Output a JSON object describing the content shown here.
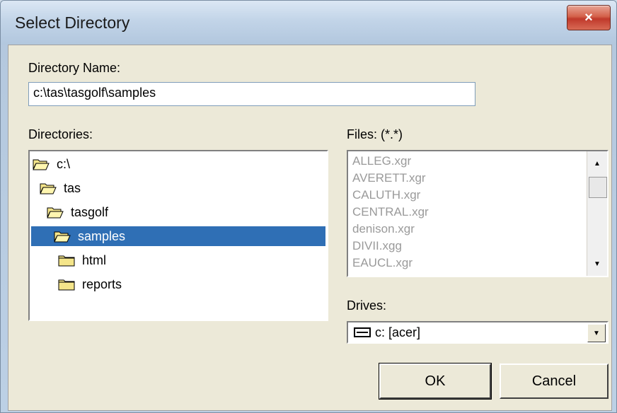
{
  "window": {
    "title": "Select Directory",
    "close_glyph": "×"
  },
  "directory_name": {
    "label": "Directory Name:",
    "value": "c:\\tas\\tasgolf\\samples"
  },
  "directories": {
    "label": "Directories:",
    "items": [
      {
        "label": "c:\\",
        "icon": "open-folder-icon",
        "selected": false
      },
      {
        "label": "tas",
        "icon": "open-folder-icon",
        "selected": false
      },
      {
        "label": "tasgolf",
        "icon": "open-folder-icon",
        "selected": false
      },
      {
        "label": "samples",
        "icon": "open-folder-icon",
        "selected": true
      },
      {
        "label": "html",
        "icon": "folder-icon",
        "selected": false
      },
      {
        "label": "reports",
        "icon": "folder-icon",
        "selected": false
      }
    ]
  },
  "files": {
    "label": "Files: (*.*)",
    "items": [
      "ALLEG.xgr",
      "AVERETT.xgr",
      "CALUTH.xgr",
      "CENTRAL.xgr",
      "denison.xgr",
      "DIVII.xgg",
      "EAUCL.xgr"
    ]
  },
  "drives": {
    "label": "Drives:",
    "selected": "c: [acer]"
  },
  "buttons": {
    "ok": "OK",
    "cancel": "Cancel"
  },
  "colors": {
    "selection": "#2f6fb5",
    "close_button": "#c0392b",
    "dialog_face": "#ece9d8"
  }
}
